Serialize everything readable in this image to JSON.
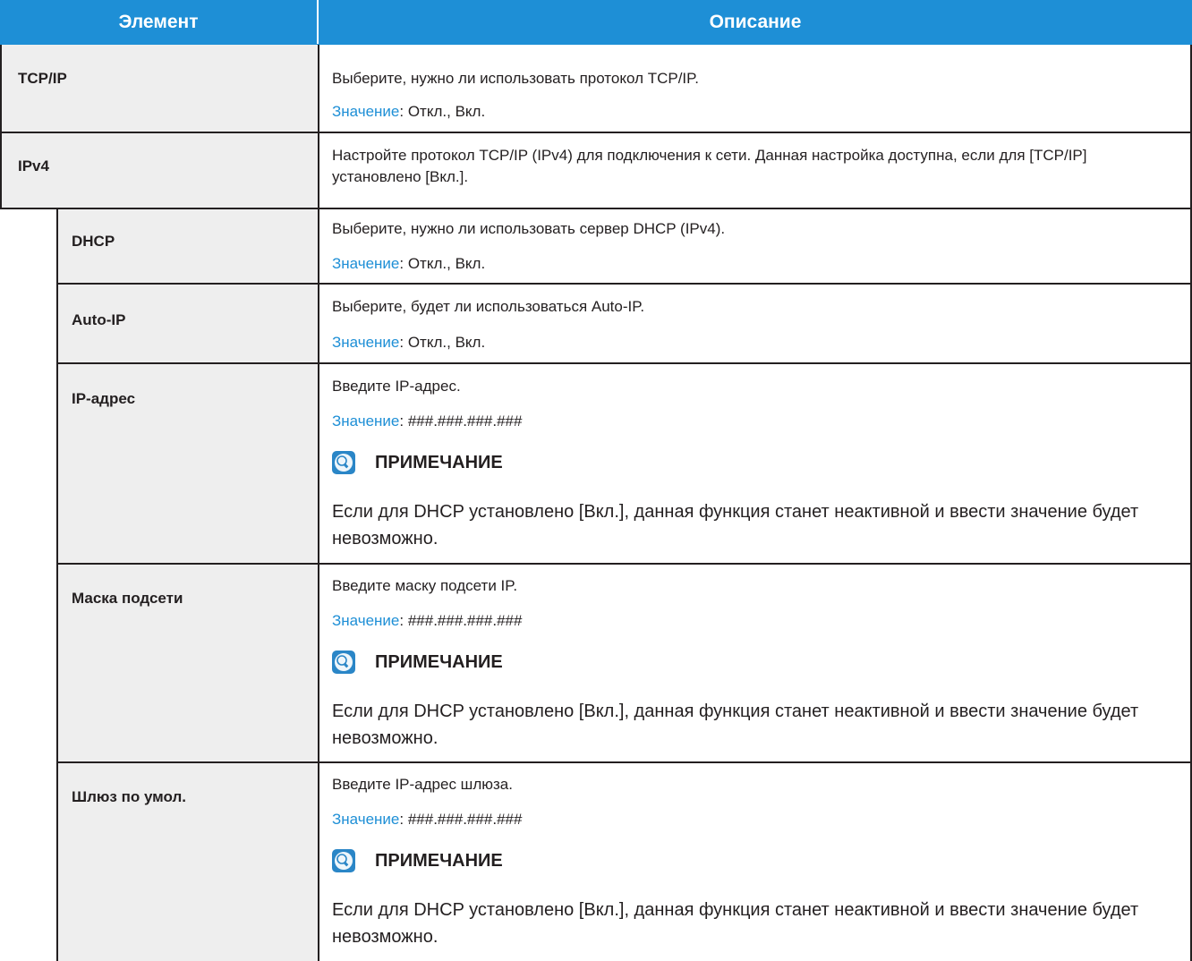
{
  "header": {
    "col_item": "Элемент",
    "col_desc": "Описание"
  },
  "value_label": "Значение",
  "note_title": "ПРИМЕЧАНИЕ",
  "rows": [
    {
      "item": "TCP/IP",
      "desc": "Выберите, нужно ли использовать протокол TCP/IP.",
      "value": ": Откл., Вкл."
    },
    {
      "item": "IPv4",
      "desc": "Настройте протокол TCP/IP (IPv4) для подключения к сети. Данная настройка доступна, если для [TCP/IP] установлено [Вкл.]."
    },
    {
      "item": "DHCP",
      "desc": "Выберите, нужно ли использовать сервер DHCP (IPv4).",
      "value": ": Откл., Вкл."
    },
    {
      "item": "Auto-IP",
      "desc": "Выберите, будет ли использоваться Auto-IP.",
      "value": ": Откл., Вкл."
    },
    {
      "item": "IP-адрес",
      "desc": "Введите IP-адрес.",
      "value": ": ###.###.###.###",
      "note": "Если для DHCP установлено [Вкл.], данная функция станет неактивной и ввести значение будет невозможно."
    },
    {
      "item": "Маска подсети",
      "desc": "Введите маску подсети IP.",
      "value": ": ###.###.###.###",
      "note": "Если для DHCP установлено [Вкл.], данная функция станет неактивной и ввести значение будет невозможно."
    },
    {
      "item": "Шлюз по умол.",
      "desc": "Введите IP-адрес шлюза.",
      "value": ": ###.###.###.###",
      "note": "Если для DHCP установлено [Вкл.], данная функция станет неактивной и ввести значение будет невозможно."
    }
  ]
}
